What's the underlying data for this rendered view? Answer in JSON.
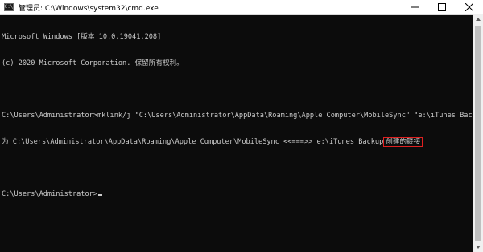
{
  "window": {
    "title": "管理员: C:\\Windows\\system32\\cmd.exe",
    "icon_name": "cmd-icon",
    "icon_text": "C:\\"
  },
  "controls": {
    "minimize_icon": "minimize-icon",
    "maximize_icon": "maximize-icon",
    "close_icon": "close-icon"
  },
  "console": {
    "lines": [
      "Microsoft Windows [版本 10.0.19041.208]",
      "(c) 2020 Microsoft Corporation. 保留所有权利。",
      "",
      "C:\\Users\\Administrator>mklink/j \"C:\\Users\\Administrator\\AppData\\Roaming\\Apple Computer\\MobileSync\" \"e:\\iTunes Backup\"",
      "为 C:\\Users\\Administrator\\AppData\\Roaming\\Apple Computer\\MobileSync <<===>> e:\\iTunes Backup",
      "",
      "C:\\Users\\Administrator>"
    ],
    "highlighted_text": "创建的联接",
    "highlight_color": "#e02020",
    "text_color": "#cccccc",
    "background_color": "#0c0c0c"
  }
}
